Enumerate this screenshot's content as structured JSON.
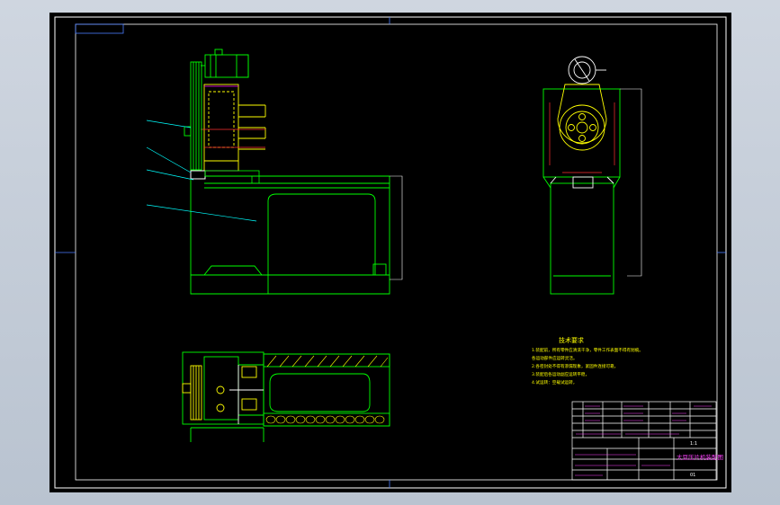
{
  "drawing": {
    "background": "#000000",
    "colors": {
      "frame": "#ffffff",
      "part": "#00ff00",
      "machine": "#ffff00",
      "hidden": "#ff3030",
      "belt": "#ff00ff",
      "cabinet": "#00e0ff",
      "leader": "#00ffff",
      "table_text": "#ff40ff"
    }
  },
  "notes": {
    "heading": "技术要求",
    "lines": [
      "1.装配前，所有零件应清洗干净，零件工作表面不得有划痕。",
      "各运动部件应运转灵活。",
      "2.各密封处不得有渗漏现象，紧固件连接可靠，",
      "3.装配后各运动副应运转平稳，",
      "4.试运转：空载试运转，"
    ]
  },
  "title_block": {
    "drawing_title": "大豆压片机装配图",
    "scale": "1:1",
    "sheet": "01"
  }
}
